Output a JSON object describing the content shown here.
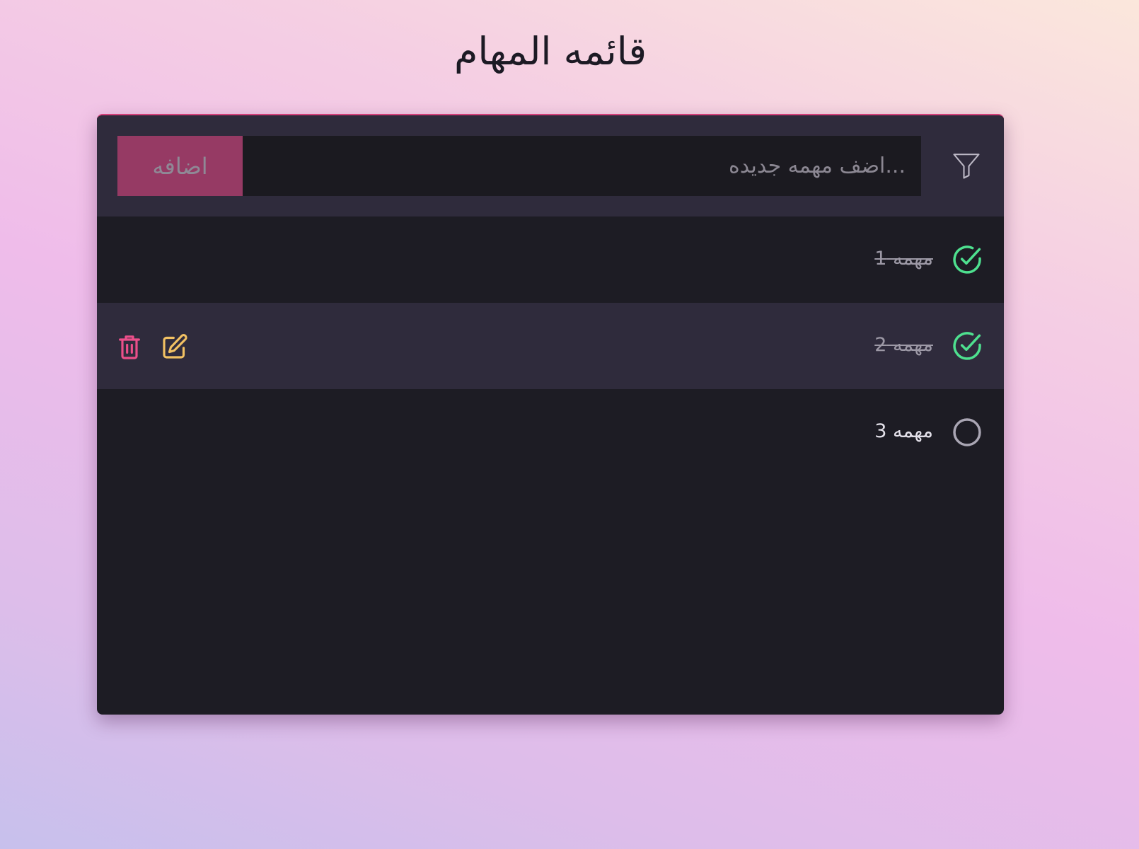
{
  "app": {
    "title": "قائمه المهام"
  },
  "toolbar": {
    "filter_icon": "filter-funnel-icon",
    "input_placeholder": "...اضف مهمه جديده",
    "input_value": "",
    "add_button_label": "اضافه"
  },
  "tasks": [
    {
      "label": "مهمه 1",
      "completed": true
    },
    {
      "label": "مهمه 2",
      "completed": true,
      "hovered": true,
      "actions": [
        "edit",
        "delete"
      ]
    },
    {
      "label": "مهمه 3",
      "completed": false
    }
  ],
  "colors": {
    "card_background": "#1d1c24",
    "toolbar_background": "#2f2b3c",
    "accent": "#963a64",
    "done_check": "#4ee08f",
    "edit_icon": "#f2c163",
    "delete_icon": "#ec4f8a",
    "pending_circle": "#aaa6b4"
  },
  "icons": {
    "completed": "check-circle-icon",
    "pending": "empty-circle-icon",
    "edit": "edit-pencil-icon",
    "delete": "trash-icon"
  }
}
